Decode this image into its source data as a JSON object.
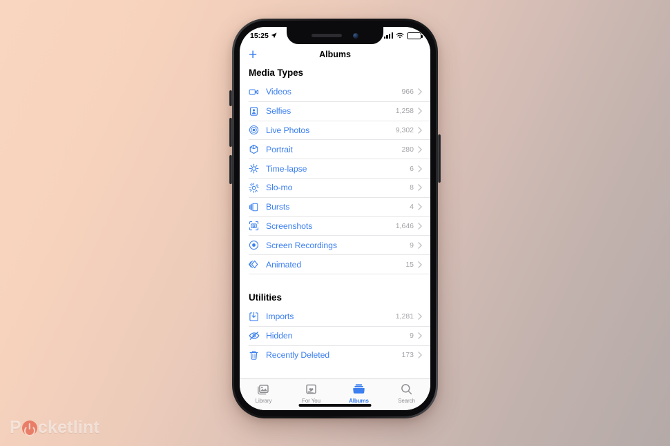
{
  "watermark": {
    "text_before": "P",
    "text_after": "cketlint",
    "icon": "power-icon",
    "accent": "#e8705a"
  },
  "phone": {
    "status_bar": {
      "time": "15:25",
      "location_icon": "location-arrow-icon",
      "signal_icon": "cellular-signal-icon",
      "wifi_icon": "wifi-icon",
      "battery_icon": "battery-icon",
      "battery_level": "60"
    },
    "nav_bar": {
      "add_label": "+",
      "add_icon": "plus-icon",
      "title": "Albums"
    },
    "sections": [
      {
        "id": "media-types",
        "header": "Media Types",
        "rows": [
          {
            "label": "Videos",
            "count": "966",
            "icon": "video-camera-icon"
          },
          {
            "label": "Selfies",
            "count": "1,258",
            "icon": "selfie-person-icon"
          },
          {
            "label": "Live Photos",
            "count": "9,302",
            "icon": "live-photo-icon"
          },
          {
            "label": "Portrait",
            "count": "280",
            "icon": "portrait-cube-icon"
          },
          {
            "label": "Time-lapse",
            "count": "6",
            "icon": "timelapse-icon"
          },
          {
            "label": "Slo-mo",
            "count": "8",
            "icon": "slomo-icon"
          },
          {
            "label": "Bursts",
            "count": "4",
            "icon": "bursts-stack-icon"
          },
          {
            "label": "Screenshots",
            "count": "1,646",
            "icon": "screenshot-camera-icon"
          },
          {
            "label": "Screen Recordings",
            "count": "9",
            "icon": "screen-recording-icon"
          },
          {
            "label": "Animated",
            "count": "15",
            "icon": "animated-chevrons-icon"
          }
        ]
      },
      {
        "id": "utilities",
        "header": "Utilities",
        "rows": [
          {
            "label": "Imports",
            "count": "1,281",
            "icon": "import-download-icon"
          },
          {
            "label": "Hidden",
            "count": "9",
            "icon": "hidden-eye-slash-icon"
          },
          {
            "label": "Recently Deleted",
            "count": "173",
            "icon": "trash-icon"
          }
        ]
      }
    ],
    "tab_bar": {
      "tabs": [
        {
          "label": "Library",
          "icon": "photos-library-icon",
          "active": false
        },
        {
          "label": "For You",
          "icon": "for-you-heart-icon",
          "active": false
        },
        {
          "label": "Albums",
          "icon": "albums-folder-icon",
          "active": true
        },
        {
          "label": "Search",
          "icon": "search-magnifier-icon",
          "active": false
        }
      ]
    },
    "colors": {
      "accent": "#3b7ff0",
      "inactive": "#8e8e93",
      "count_text": "#a3a3a8"
    }
  }
}
